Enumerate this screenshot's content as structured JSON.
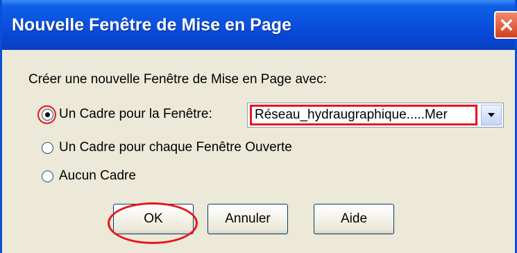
{
  "window": {
    "title": "Nouvelle Fenêtre de Mise en Page"
  },
  "dialog": {
    "prompt": "Créer une nouvelle Fenêtre de Mise en Page avec:",
    "options": [
      {
        "label": "Un Cadre pour la Fenêtre:",
        "checked": true
      },
      {
        "label": "Un Cadre pour chaque Fenêtre Ouverte",
        "checked": false
      },
      {
        "label": "Aucun Cadre",
        "checked": false
      }
    ],
    "window_select": {
      "value": "Réseau_hydraugraphique.....Mer"
    },
    "buttons": {
      "ok": "OK",
      "cancel": "Annuler",
      "help": "Aide"
    }
  },
  "colors": {
    "titlebar": "#0a52de",
    "highlight": "#e8141a",
    "dialog_bg": "#ece9d8",
    "close_button": "#d2401f"
  },
  "icons": {
    "close": "close-icon",
    "dropdown": "chevron-down-icon"
  }
}
